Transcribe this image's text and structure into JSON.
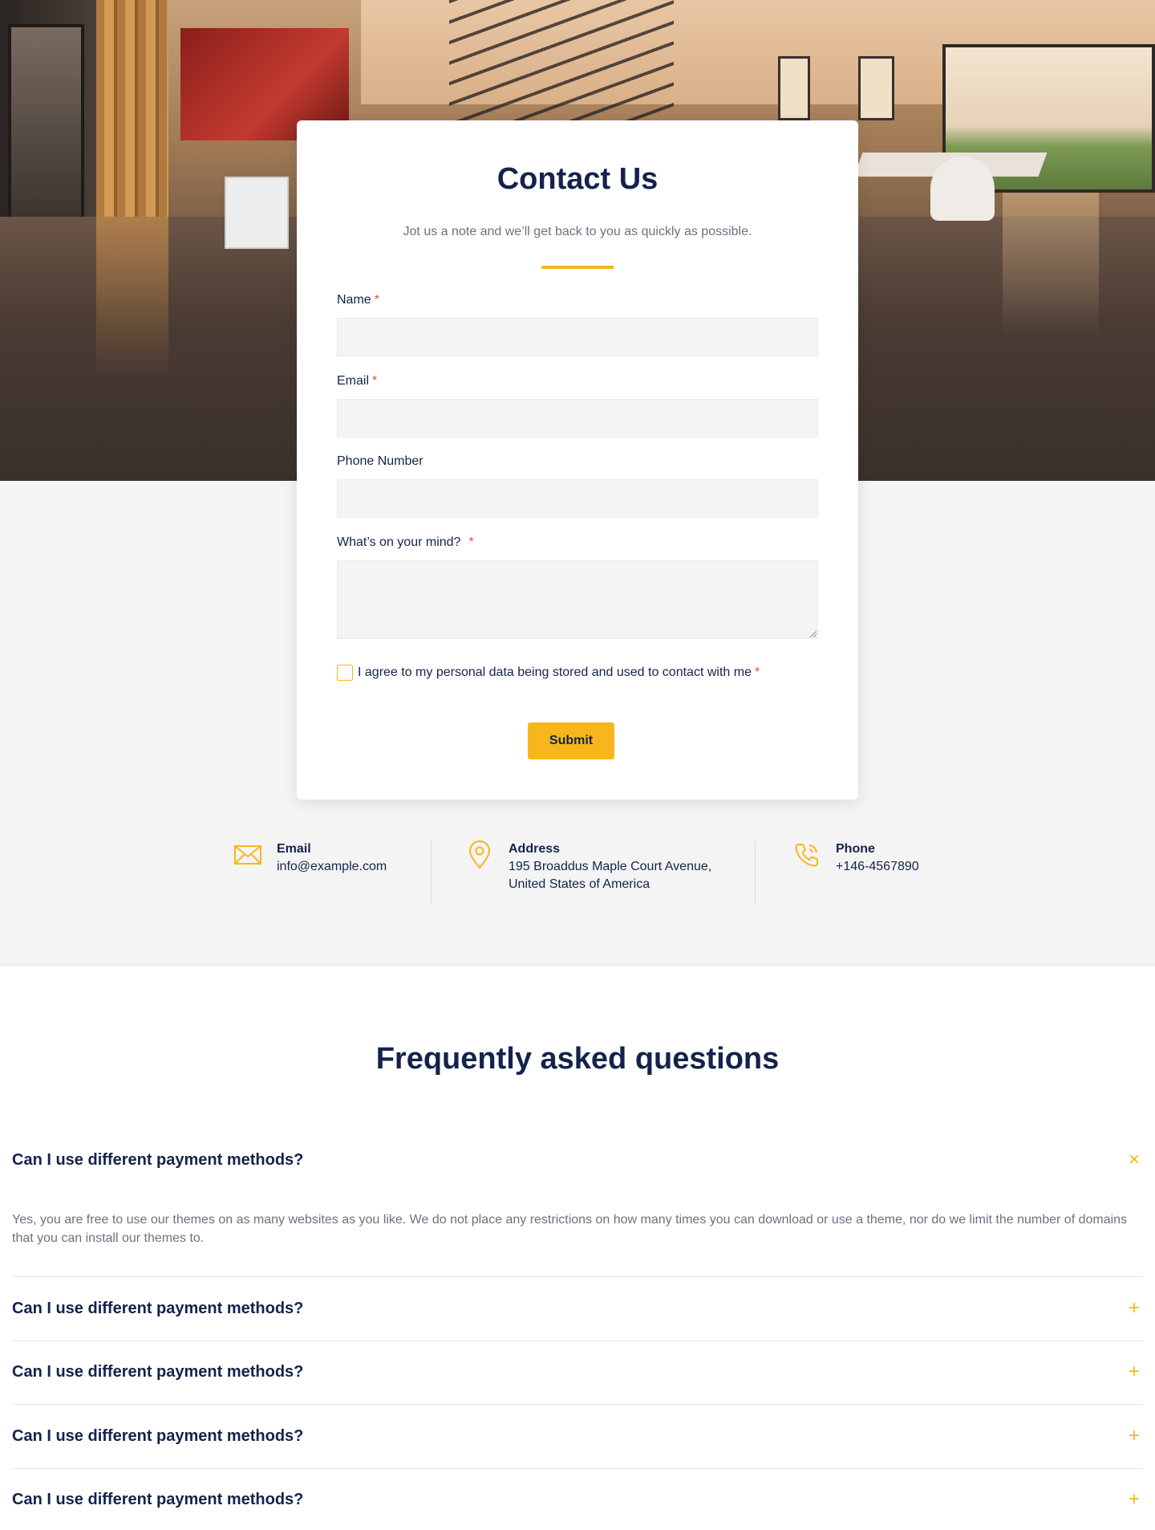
{
  "contact": {
    "title": "Contact Us",
    "subtitle": "Jot us a note and we’ll get back to you as quickly as possible.",
    "fields": {
      "name_label": "Name",
      "email_label": "Email",
      "phone_label": "Phone Number",
      "message_label": "What’s on your mind?",
      "required_mark": "*"
    },
    "consent_text": "I agree to my personal data being stored and used to contact with me",
    "submit_label": "Submit"
  },
  "info": {
    "email": {
      "label": "Email",
      "value": "info@example.com",
      "icon": "envelope-icon"
    },
    "address": {
      "label": "Address",
      "line1": "195 Broaddus Maple Court Avenue,",
      "line2": "United States of America",
      "icon": "map-pin-icon"
    },
    "phone": {
      "label": "Phone",
      "value": "+146-4567890",
      "icon": "phone-icon"
    }
  },
  "faq": {
    "title": "Frequently asked questions",
    "items": [
      {
        "question": "Can I use different payment methods?",
        "expanded": true,
        "answer": "Yes, you are free to use our themes on as many websites as you like. We do not place any restrictions on how many times you can download or use a theme, nor do we limit the number of domains that you can install our themes to."
      },
      {
        "question": "Can I use different payment methods?",
        "expanded": false
      },
      {
        "question": "Can I use different payment methods?",
        "expanded": false
      },
      {
        "question": "Can I use different payment methods?",
        "expanded": false
      },
      {
        "question": "Can I use different payment methods?",
        "expanded": false
      }
    ],
    "toggle_open": "×",
    "toggle_closed": "+"
  },
  "colors": {
    "accent": "#f7b71c",
    "heading": "#14234b",
    "muted": "#6b7280",
    "required": "#e0532f",
    "section_bg": "#f4f4f4"
  }
}
